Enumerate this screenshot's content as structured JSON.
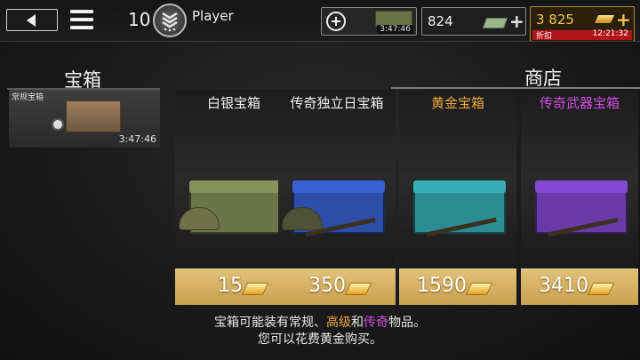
{
  "topbar": {
    "level": "10",
    "player_name": "Player",
    "chest_slot_timer": "3:47:46",
    "cash": "824",
    "gold": "3 825",
    "discount_label": "折扣",
    "discount_timer": "12:21:32"
  },
  "sections": {
    "left_title": "宝箱",
    "right_title": "商店"
  },
  "owned_chest": {
    "label": "常规宝箱",
    "timer": "3:47:46"
  },
  "shop": {
    "cards": [
      {
        "title": "白银宝箱",
        "price": "15",
        "title_color": "#f0f0f0",
        "crate_color": "#6b7548"
      },
      {
        "title": "传奇独立日宝箱",
        "price": "350",
        "title_color": "#f0f0f0",
        "crate_color": "#2d4ea8"
      },
      {
        "title": "黄金宝箱",
        "price": "1590",
        "title_color": "#f0a93a",
        "crate_color": "#2b8c93"
      },
      {
        "title": "传奇武器宝箱",
        "price": "3410",
        "title_color": "#d04be0",
        "crate_color": "#6a3aa8"
      }
    ]
  },
  "footer": {
    "line1_a": "宝箱可能装有常规、",
    "line1_b": "高级",
    "line1_c": "和",
    "line1_d": "传奇",
    "line1_e": "物品。",
    "line2": "您可以花费黄金购买。"
  },
  "colors": {
    "advanced": "#f0a93a",
    "legendary": "#d04be0",
    "gold_text": "#f1c24d",
    "price_bg": "#d6b264"
  },
  "icons": [
    "back-arrow-icon",
    "menu-icon",
    "rank-badge-icon",
    "plus-circle-icon",
    "cash-icon",
    "gold-bar-icon",
    "clock-icon"
  ]
}
